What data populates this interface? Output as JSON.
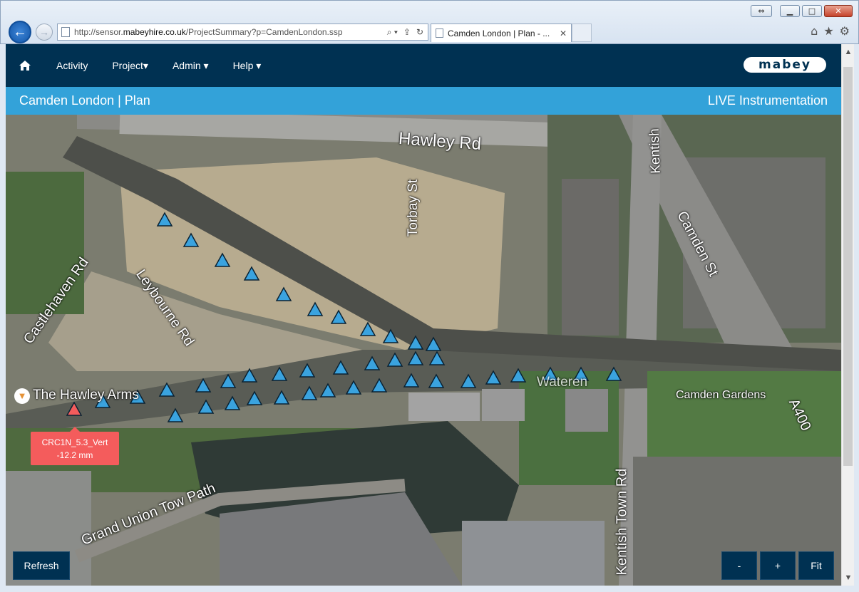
{
  "browser": {
    "url_prefix": "http://sensor.",
    "url_domain": "mabeyhire.co.uk",
    "url_path": "/ProjectSummary?p=CamdenLondon.ssp",
    "tab_title": "Camden London | Plan - ...",
    "tab_close": "✕",
    "back_glyph": "←",
    "forward_glyph": "→",
    "search_glyph": "⌕ ▾",
    "lock_glyph": "⇪",
    "refresh_glyph": "↻",
    "home_glyph": "⌂",
    "favorites_glyph": "★",
    "settings_glyph": "⚙",
    "restore_glyph": "⇔",
    "minimize_glyph": "▁",
    "maximize_glyph": "□",
    "close_glyph": "✕"
  },
  "nav": {
    "items": [
      {
        "label": "Activity"
      },
      {
        "label": "Project▾"
      },
      {
        "label": "Admin ▾"
      },
      {
        "label": "Help ▾"
      }
    ],
    "logo_text": "mabey"
  },
  "header": {
    "title": "Camden London | Plan",
    "status": "LIVE Instrumentation"
  },
  "map": {
    "labels": {
      "hawley_rd": "Hawley Rd",
      "torbay_st": "Torbay St",
      "kentish": "Kentish",
      "camden_st": "Camden St",
      "castlehaven_rd": "Castlehaven Rd",
      "leybourne_rd": "Leybourne Rd",
      "hawley_arms": "The Hawley Arms",
      "camden_gardens": "Camden Gardens",
      "camden_gardens_2": "Gardens",
      "a400": "A400",
      "grand_union": "Grand Union Tow Path",
      "kentish_town_rd": "Kentish Town Rd",
      "water": "Wateren"
    },
    "alert_sensor": {
      "name": "CRC1N_5.3_Vert",
      "value": "-12.2 mm"
    },
    "colors": {
      "sensor_normal": "#3aa3df",
      "sensor_alert": "#f45c5c"
    }
  },
  "controls": {
    "refresh": "Refresh",
    "zoom_out": "-",
    "zoom_in": "+",
    "fit": "Fit"
  }
}
